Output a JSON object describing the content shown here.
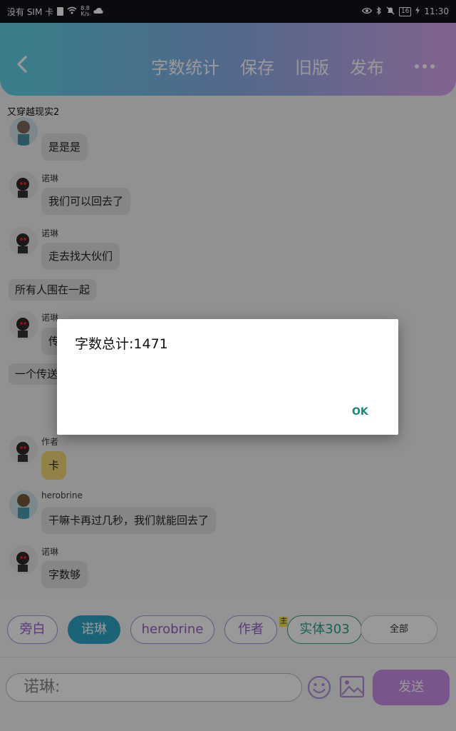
{
  "status_bar": {
    "carrier": "没有 SIM 卡",
    "net_speed_value": "8.8",
    "net_speed_unit": "K/s",
    "battery": "16",
    "time": "11:30"
  },
  "header": {
    "actions": [
      "字数统计",
      "保存",
      "旧版",
      "发布"
    ]
  },
  "chat_title": "又穿越现实2",
  "messages": [
    {
      "sender": "",
      "text": "是是是"
    },
    {
      "sender": "诺琳",
      "text": "我们可以回去了"
    },
    {
      "sender": "诺琳",
      "text": "走去找大伙们"
    },
    {
      "narration": "所有人围在一起"
    },
    {
      "sender": "诺琳",
      "text": "传"
    },
    {
      "narration": "一个传送"
    },
    {
      "sender": "作者",
      "text": "卡"
    },
    {
      "sender": "herobrine",
      "text": "干嘛卡再过几秒，我们就能回去了"
    },
    {
      "sender": "诺琳",
      "text": "字数够"
    }
  ],
  "role_chips": [
    "旁白",
    "诺琳",
    "herobrine",
    "作者",
    "实体303",
    "全部"
  ],
  "main_tag": "主",
  "input": {
    "prefix": "诺琳:"
  },
  "send_label": "发送",
  "dialog": {
    "message": "字数总计:1471",
    "ok_label": "OK"
  },
  "colors": {
    "header_gradient_start": "#5fd3e6",
    "header_gradient_end": "#d8a6ef",
    "active_chip": "#2ea5c7",
    "send_button": "#c98ee8",
    "dialog_ok": "#138a7a"
  }
}
